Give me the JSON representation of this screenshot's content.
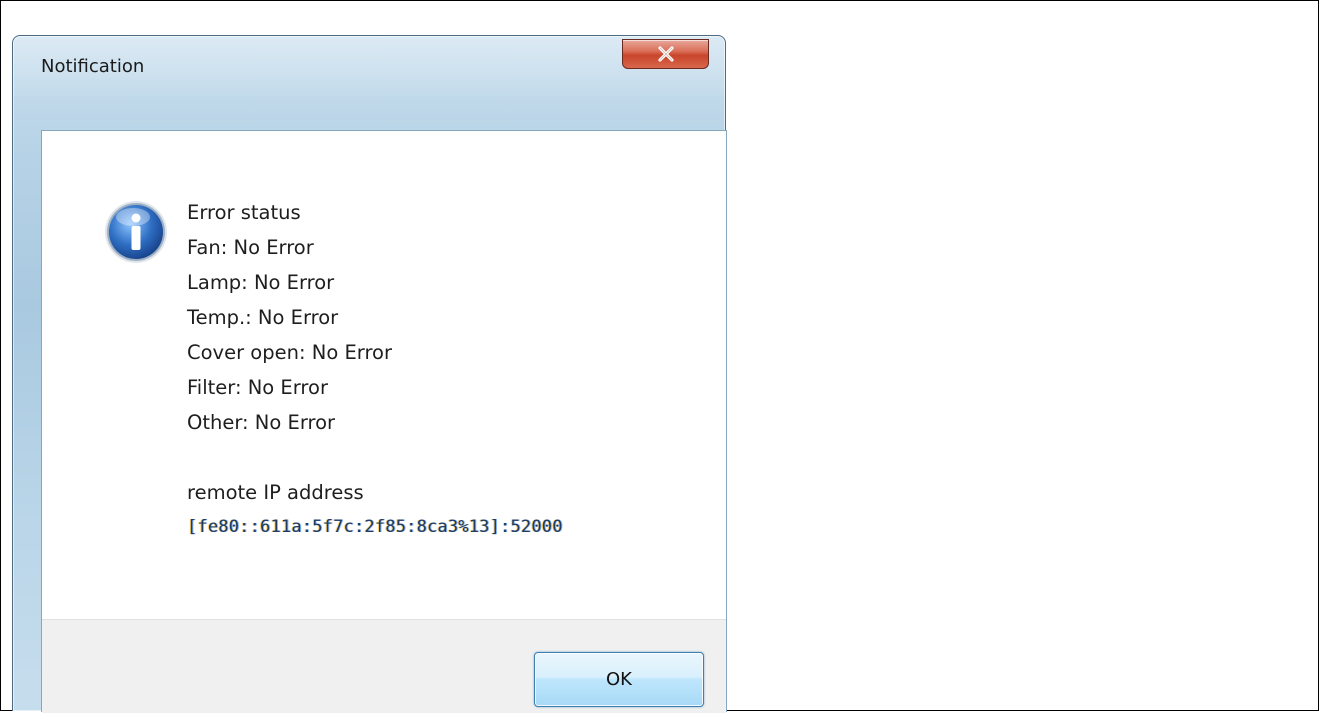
{
  "dialog": {
    "title": "Notification",
    "icon": "info-icon",
    "message_lines": [
      "Error status",
      "Fan: No Error",
      "Lamp: No Error",
      "Temp.: No Error",
      "Cover open: No Error",
      "Filter: No Error",
      "Other: No Error"
    ],
    "remote_label": "remote IP address",
    "remote_ip": "[fe80::611a:5f7c:2f85:8ca3%13]:52000",
    "ok_label": "OK",
    "close_icon": "close-icon"
  },
  "colors": {
    "close_button": "#c8452b",
    "ok_border": "#3c7fb1",
    "footer_bg": "#f0f0f0",
    "info_icon_blue": "#2f6fc4"
  }
}
